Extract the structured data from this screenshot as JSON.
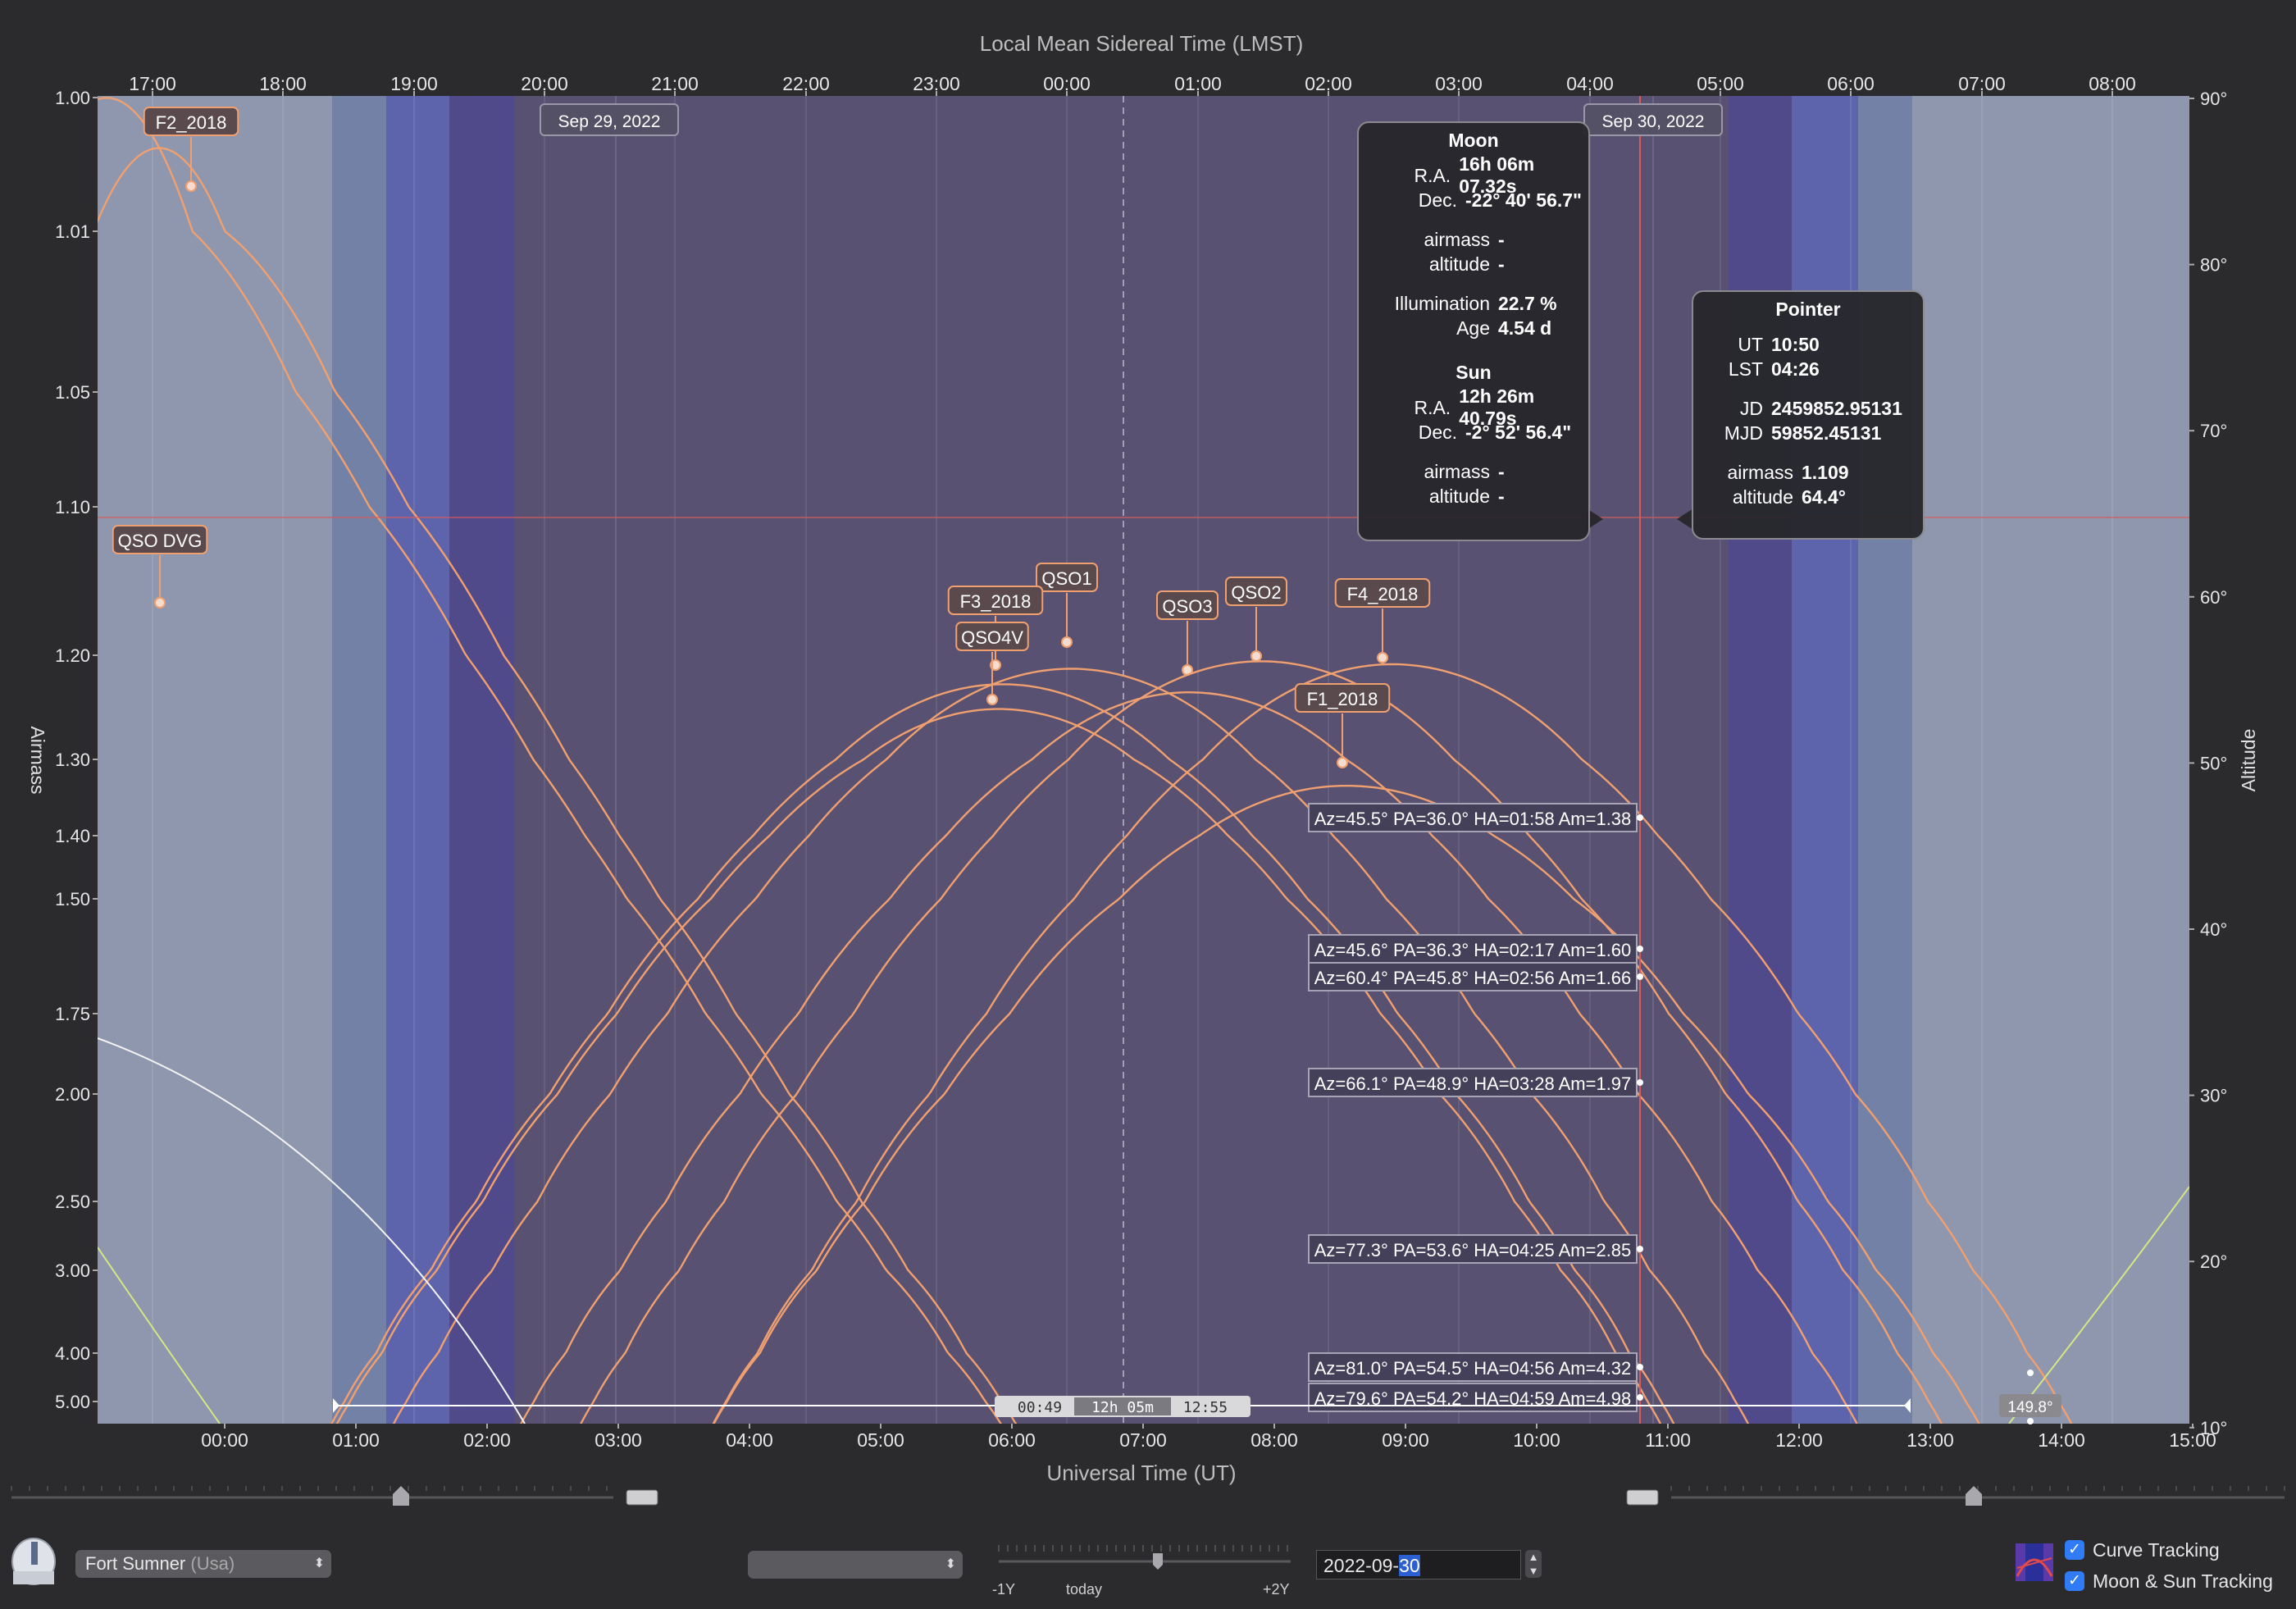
{
  "axes": {
    "top_title": "Local Mean Sidereal Time (LMST)",
    "bottom_title": "Universal Time (UT)",
    "left_title": "Airmass",
    "right_title": "Altitude",
    "top_ticks": [
      "17:00",
      "18:00",
      "19:00",
      "20:00",
      "21:00",
      "22:00",
      "23:00",
      "00:00",
      "01:00",
      "02:00",
      "03:00",
      "04:00",
      "05:00",
      "06:00",
      "07:00",
      "08:00"
    ],
    "bottom_ticks": [
      "00:00",
      "01:00",
      "02:00",
      "03:00",
      "04:00",
      "05:00",
      "06:00",
      "07:00",
      "08:00",
      "09:00",
      "10:00",
      "11:00",
      "12:00",
      "13:00",
      "14:00",
      "15:00"
    ],
    "left_ticks": [
      "1.00",
      "1.01",
      "1.05",
      "1.10",
      "1.20",
      "1.30",
      "1.40",
      "1.50",
      "1.75",
      "2.00",
      "2.50",
      "3.00",
      "4.00",
      "5.00"
    ],
    "right_ticks": [
      "90°",
      "80°",
      "70°",
      "60°",
      "50°",
      "40°",
      "30°",
      "20°",
      "10°"
    ]
  },
  "dates": {
    "first": "Sep 29, 2022",
    "second": "Sep 30, 2022"
  },
  "colors": {
    "background": "#2b2b2d",
    "day": "#8e97ad",
    "civil": "#7381a6",
    "nautical": "#5d64ab",
    "astronomical": "#514a8a",
    "night": "#585171",
    "curve": "#f0a070",
    "pointer": "#d85c5c",
    "moon_curve": "#f4f4f4",
    "sun_curve": "#d6e585",
    "accent": "#2f7cf6"
  },
  "targets": [
    {
      "name": "F2_2018"
    },
    {
      "name": "QSO DVG"
    },
    {
      "name": "QSO1"
    },
    {
      "name": "F3_2018"
    },
    {
      "name": "QSO4V"
    },
    {
      "name": "QSO3"
    },
    {
      "name": "QSO2"
    },
    {
      "name": "F4_2018"
    },
    {
      "name": "F1_2018"
    }
  ],
  "pointer_readouts": [
    "Az=45.5° PA=36.0° HA=01:58 Am=1.38",
    "Az=45.6° PA=36.3° HA=02:17 Am=1.60",
    "Az=60.4° PA=45.8° HA=02:56 Am=1.66",
    "Az=66.1° PA=48.9° HA=03:28 Am=1.97",
    "Az=77.3° PA=53.6° HA=04:25 Am=2.85",
    "Az=81.0° PA=54.5° HA=04:56 Am=4.32",
    "Az=79.6° PA=54.2° HA=04:59 Am=4.98"
  ],
  "moon_info": {
    "title": "Moon",
    "ra_label": "R.A.",
    "ra": "16h 06m 07.32s",
    "dec_label": "Dec.",
    "dec": "-22° 40' 56.7\"",
    "airmass_label": "airmass",
    "airmass": "-",
    "altitude_label": "altitude",
    "altitude": "-",
    "illum_label": "Illumination",
    "illum": "22.7 %",
    "age_label": "Age",
    "age": "4.54 d"
  },
  "sun_info": {
    "title": "Sun",
    "ra_label": "R.A.",
    "ra": "12h 26m 40.79s",
    "dec_label": "Dec.",
    "dec": "-2° 52' 56.4\"",
    "airmass_label": "airmass",
    "airmass": "-",
    "altitude_label": "altitude",
    "altitude": "-"
  },
  "pointer_info": {
    "title": "Pointer",
    "ut_label": "UT",
    "ut": "10:50",
    "lst_label": "LST",
    "lst": "04:26",
    "jd_label": "JD",
    "jd": "2459852.95131",
    "mjd_label": "MJD",
    "mjd": "59852.45131",
    "airmass_label": "airmass",
    "airmass": "1.109",
    "altitude_label": "altitude",
    "altitude": "64.4°"
  },
  "night_bar": {
    "start": "00:49",
    "duration": "12h 05m",
    "end": "12:55"
  },
  "moon_sep_label": "149.8°",
  "controls": {
    "site_name": "Fort Sumner",
    "site_country": "(Usa)",
    "time_slider": {
      "left": "-1Y",
      "center": "today",
      "right": "+2Y"
    },
    "date_prefix": "2022-09-",
    "date_day": "30",
    "curve_tracking": "Curve Tracking",
    "moon_sun_tracking": "Moon & Sun Tracking",
    "curve_tracking_checked": true,
    "moon_sun_tracking_checked": true
  }
}
